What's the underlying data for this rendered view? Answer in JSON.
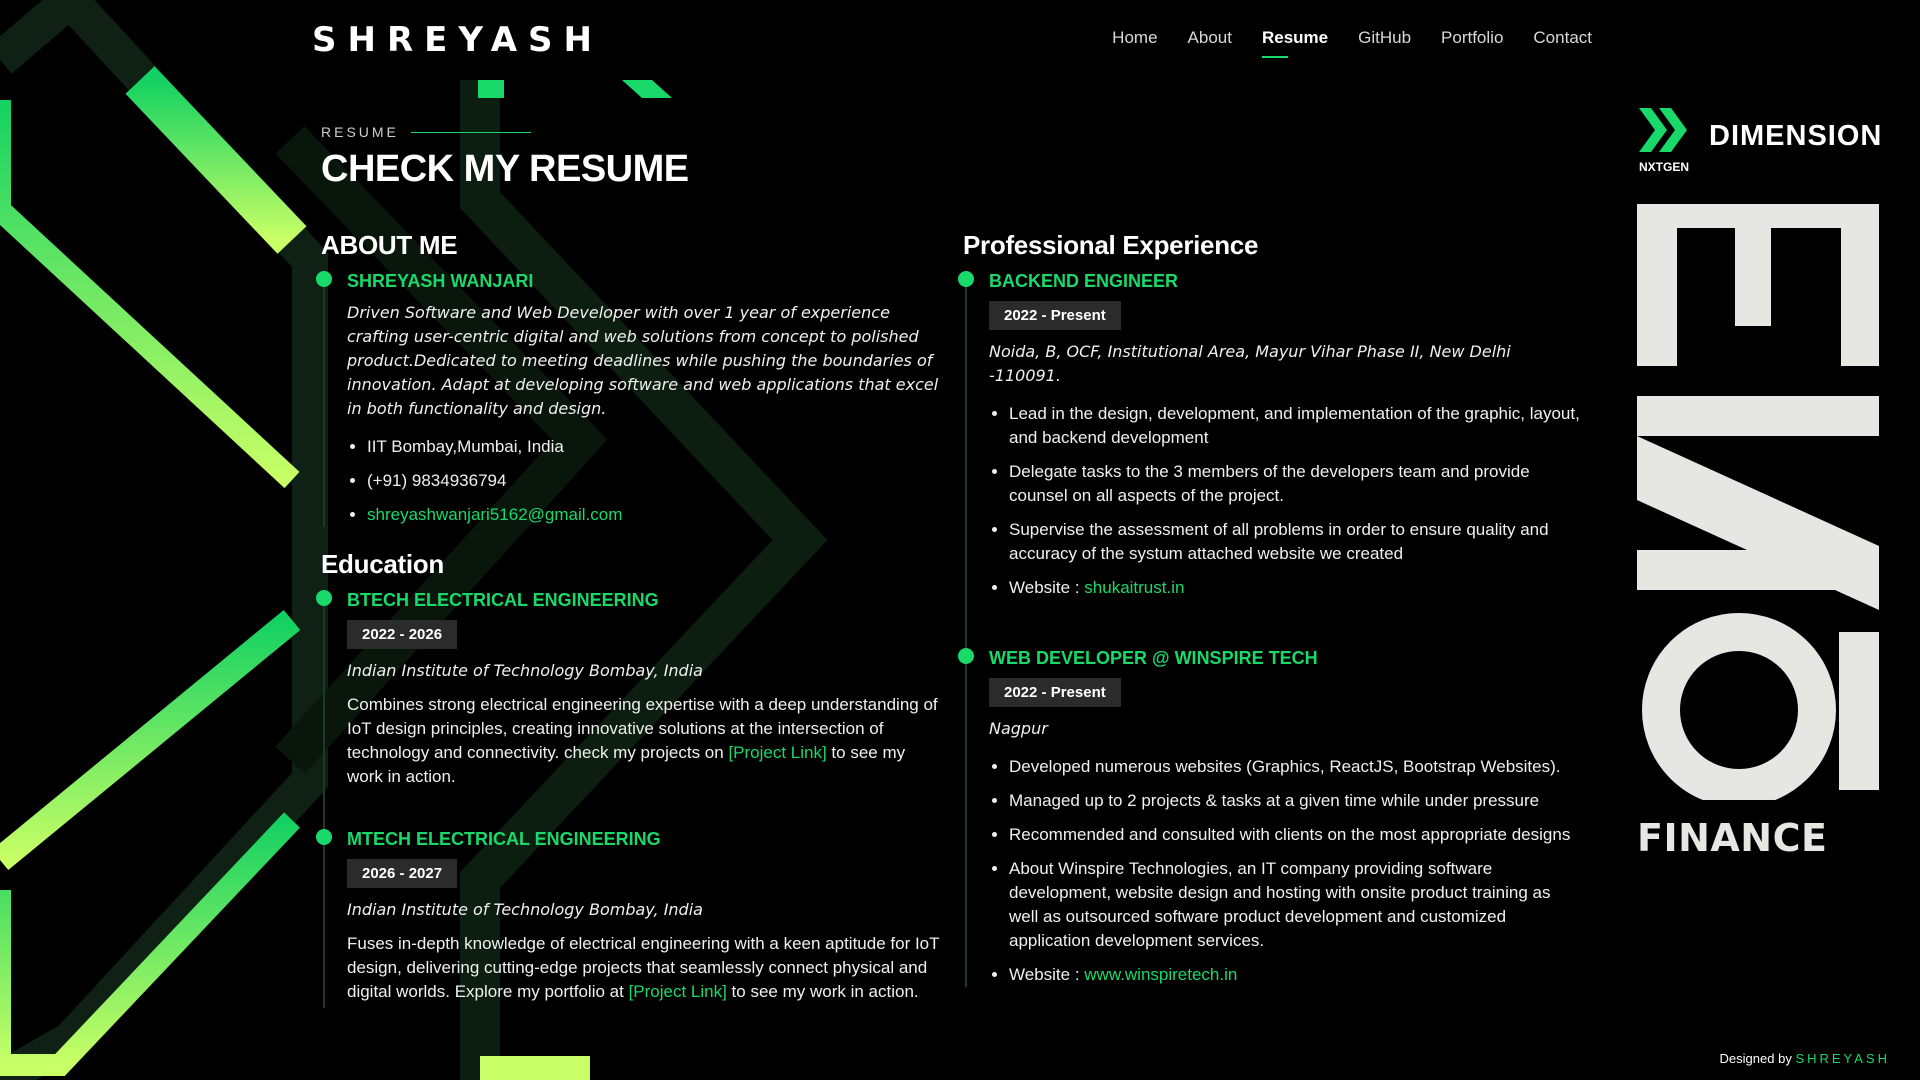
{
  "header": {
    "logo": "SHREYASH",
    "nav": [
      "Home",
      "About",
      "Resume",
      "GitHub",
      "Portfolio",
      "Contact"
    ],
    "active": "Resume"
  },
  "section": {
    "kicker": "RESUME",
    "title": "CHECK MY RESUME"
  },
  "about": {
    "heading": "ABOUT ME",
    "name": "SHREYASH WANJARI",
    "summary": "Driven Software and Web Developer with over 1 year of experience crafting user-centric digital and web solutions from concept to polished product.Dedicated to meeting deadlines while pushing the boundaries of innovation. Adapt at developing software and web applications that excel in both functionality and design.",
    "location": "IIT Bombay,Mumbai, India",
    "phone": "(+91) 9834936794",
    "email": "shreyashwanjari5162@gmail.com"
  },
  "education": {
    "heading": "Education",
    "items": [
      {
        "title": "BTECH ELECTRICAL ENGINEERING",
        "years": "2022 - 2026",
        "institute": "Indian Institute of Technology Bombay, India",
        "text_before": "Combines strong electrical engineering expertise with a deep understanding of IoT design principles, creating innovative solutions at the intersection of technology and connectivity. check my projects on ",
        "link": "[Project Link]",
        "text_after": " to see my work in action."
      },
      {
        "title": "MTECH ELECTRICAL ENGINEERING",
        "years": "2026 - 2027",
        "institute": "Indian Institute of Technology Bombay, India",
        "text_before": "Fuses in-depth knowledge of electrical engineering with a keen aptitude for IoT design, delivering cutting-edge projects that seamlessly connect physical and digital worlds. Explore my portfolio at ",
        "link": "[Project Link]",
        "text_after": " to see my work in action."
      }
    ]
  },
  "experience": {
    "heading": "Professional Experience",
    "items": [
      {
        "title": "BACKEND ENGINEER",
        "years": "2022 - Present",
        "location": "Noida, B, OCF, Institutional Area, Mayur Vihar Phase II, New Delhi -110091.",
        "bullets": [
          "Lead in the design, development, and implementation of the graphic, layout, and backend development",
          "Delegate tasks to the 3 members of the developers team and provide counsel on all aspects of the project.",
          "Supervise the assessment of all problems in order to ensure quality and accuracy of the systum attached website we created"
        ],
        "website_label": "Website : ",
        "website": "shukaitrust.in"
      },
      {
        "title": "WEB DEVELOPER @ WINSPIRE TECH",
        "years": "2022 - Present",
        "location": "Nagpur",
        "bullets": [
          "Developed numerous websites (Graphics, ReactJS, Bootstrap Websites).",
          "Managed up to 2 projects & tasks at a given time while under pressure",
          "Recommended and consulted with clients on the most appropriate designs",
          "About Winspire Technologies, an IT company providing software development, website design and hosting with onsite product training as well as outsourced software product development and customized application development services."
        ],
        "website_label": "Website : ",
        "website": "www.winspiretech.in"
      }
    ]
  },
  "brand": {
    "dimension": "DIMENSION",
    "nxtgen": "NXTGEN",
    "one": "ONE",
    "finance": "FINANCE"
  },
  "footer": {
    "label": "Designed by ",
    "name": "SHREYASH"
  },
  "colors": {
    "accent": "#19d96a",
    "background": "#000000",
    "badge": "#2b2b2b",
    "brand_text": "#e6e6e2"
  }
}
